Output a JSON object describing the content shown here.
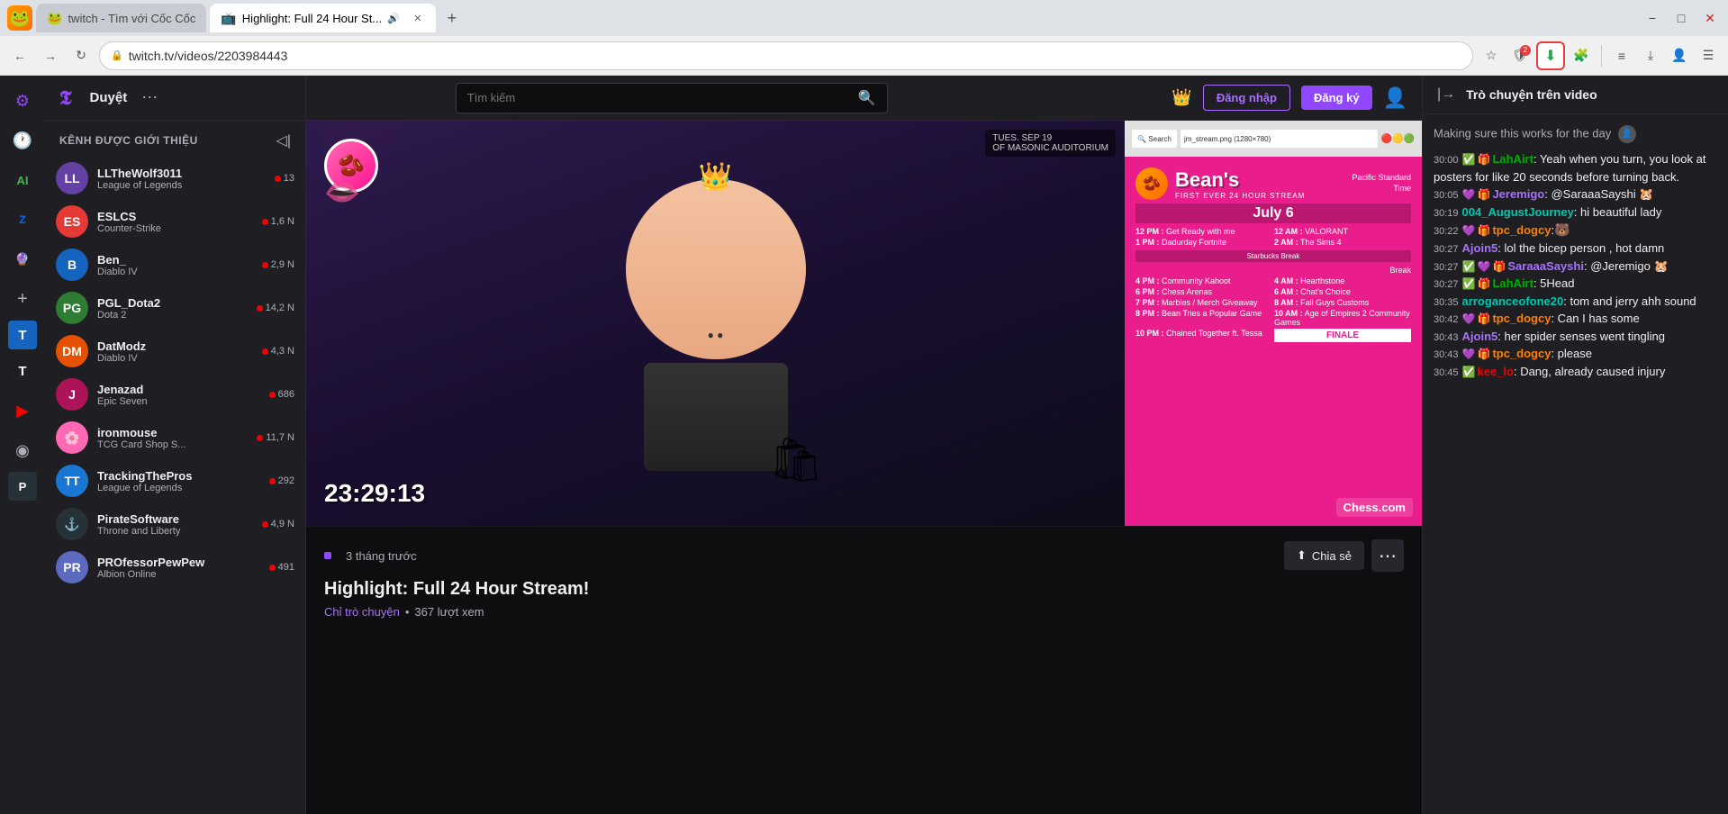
{
  "browser": {
    "tabs": [
      {
        "id": "tab1",
        "label": "twitch - Tìm với Cốc Cốc",
        "active": false,
        "favicon": "🐸"
      },
      {
        "id": "tab2",
        "label": "Highlight: Full 24 Hour St...",
        "active": true,
        "favicon": "📺",
        "audio": true
      }
    ],
    "address": "twitch.tv/videos/2203984443",
    "new_tab_label": "+",
    "window_controls": {
      "minimize": "−",
      "maximize": "□",
      "close": "✕"
    }
  },
  "left_icons": [
    {
      "id": "settings",
      "symbol": "⚙",
      "label": "settings-icon"
    },
    {
      "id": "history",
      "symbol": "🕐",
      "label": "history-icon"
    },
    {
      "id": "ai",
      "symbol": "✦",
      "label": "ai-icon"
    },
    {
      "id": "zalo",
      "symbol": "Z",
      "label": "zalo-icon"
    },
    {
      "id": "search",
      "symbol": "🔍",
      "label": "search-icon"
    },
    {
      "id": "plus",
      "symbol": "+",
      "label": "add-icon"
    },
    {
      "id": "t1",
      "symbol": "T",
      "label": "t1-icon"
    },
    {
      "id": "t2",
      "symbol": "T",
      "label": "t2-icon"
    },
    {
      "id": "youtube",
      "symbol": "▶",
      "label": "youtube-icon"
    },
    {
      "id": "other1",
      "symbol": "⊕",
      "label": "other1-icon"
    },
    {
      "id": "pirate",
      "symbol": "☠",
      "label": "pirate-icon"
    }
  ],
  "twitch": {
    "logo": "𝕿",
    "browse_label": "Duyệt",
    "search_placeholder": "Tìm kiếm",
    "crown_icon": "👑",
    "login_label": "Đăng nhập",
    "signup_label": "Đăng ký",
    "chat_title": "Trò chuyện trên video",
    "sidebar_title": "KÊNH ĐƯỢC GIỚI THIỆU",
    "collapse_symbol": "◁|",
    "channels": [
      {
        "name": "LLTheWolf3011",
        "game": "League of Legends",
        "viewers": "13",
        "avatar_class": "av-llthewolf",
        "initials": "LL"
      },
      {
        "name": "ESLCS",
        "game": "Counter-Strike",
        "viewers": "1,6 N",
        "avatar_class": "av-eslcs",
        "initials": "ES"
      },
      {
        "name": "Ben_",
        "game": "Diablo IV",
        "viewers": "2,9 N",
        "avatar_class": "av-ben",
        "initials": "B"
      },
      {
        "name": "PGL_Dota2",
        "game": "Dota 2",
        "viewers": "14,2 N",
        "avatar_class": "av-pgldota2",
        "initials": "PG"
      },
      {
        "name": "DatModz",
        "game": "Diablo IV",
        "viewers": "4,3 N",
        "avatar_class": "av-datmodz",
        "initials": "DM"
      },
      {
        "name": "Jenazad",
        "game": "Epic Seven",
        "viewers": "686",
        "avatar_class": "av-jenazad",
        "initials": "J"
      },
      {
        "name": "ironmouse",
        "game": "TCG Card Shop S...",
        "viewers": "11,7 N",
        "avatar_class": "av-ironmouse",
        "initials": "🌸"
      },
      {
        "name": "TrackingThePros",
        "game": "League of Legends",
        "viewers": "292",
        "avatar_class": "av-tracking",
        "initials": "TT"
      },
      {
        "name": "PirateSoftware",
        "game": "Throne and Liberty",
        "viewers": "4,9 N",
        "avatar_class": "av-pirate",
        "initials": "⚓"
      },
      {
        "name": "PROfessorPewPew",
        "game": "Albion Online",
        "viewers": "491",
        "avatar_class": "av-professor",
        "initials": "PR"
      }
    ],
    "video": {
      "timestamp": "23:29:13",
      "chess_watermark": "Chess.com",
      "age": "3 tháng trước",
      "title": "Highlight: Full 24 Hour Stream!",
      "channel_link": "Chỉ trò chuyện",
      "dot": "•",
      "views": "367 lượt xem",
      "share_label": "Chia sẻ",
      "more_symbol": "⋯"
    },
    "chat_messages": [
      {
        "time": "",
        "user": "",
        "color": "",
        "text": "Making sure this works for the day",
        "system": true
      },
      {
        "time": "30:00",
        "user": "LahAirt",
        "color": "green",
        "text": ": Yeah when you turn, you look at posters for like 20 seconds before turning back.",
        "badges": [
          "✅",
          "🎁"
        ]
      },
      {
        "time": "30:05",
        "user": "Jeremigo",
        "color": "purple",
        "text": ": @SaraaaSayshi 🐹",
        "badges": [
          "💜",
          "🎁"
        ]
      },
      {
        "time": "30:19",
        "user": "004_AugustJourney",
        "color": "blue",
        "text": ": hi beautiful lady",
        "badges": []
      },
      {
        "time": "30:22",
        "user": "tpc_dogcy",
        "color": "orange",
        "text": ":",
        "badges": [
          "💜",
          "🎁"
        ],
        "emoji_after": "🐻"
      },
      {
        "time": "30:27",
        "user": "Ajoin5",
        "color": "purple",
        "text": ": lol the bicep person , hot damn",
        "badges": []
      },
      {
        "time": "30:27",
        "user": "SaraaaSayshi",
        "color": "purple",
        "text": ": @Jeremigo 🐹",
        "badges": [
          "✅",
          "💜",
          "🎁"
        ]
      },
      {
        "time": "30:27",
        "user": "LahAirt",
        "color": "green",
        "text": ": 5Head",
        "badges": [
          "✅",
          "🎁"
        ]
      },
      {
        "time": "30:35",
        "user": "arroganceofone20",
        "color": "blue",
        "text": ": tom and jerry ahh sound",
        "badges": []
      },
      {
        "time": "30:42",
        "user": "tpc_dogcy",
        "color": "orange",
        "text": ": Can I has some",
        "badges": [
          "💜",
          "🎁"
        ]
      },
      {
        "time": "30:43",
        "user": "Ajoin5",
        "color": "purple",
        "text": ": her spider senses went tingling",
        "badges": []
      },
      {
        "time": "30:43",
        "user": "tpc_dogcy",
        "color": "orange",
        "text": ": please",
        "badges": [
          "💜",
          "🎁"
        ]
      },
      {
        "time": "30:45",
        "user": "kee_lo",
        "color": "red",
        "text": ": Dang, already caused injury",
        "badges": [
          "✅"
        ]
      }
    ]
  },
  "icons": {
    "back": "←",
    "forward": "→",
    "refresh": "↻",
    "lock": "🔒",
    "star": "☆",
    "shield": "🛡",
    "download": "⬇",
    "extensions": "🧩",
    "menu_dots": "≡",
    "share": "⬆",
    "more_vert": "⋮",
    "collapse_chat": "|→",
    "sidebar_search": "🔍"
  }
}
